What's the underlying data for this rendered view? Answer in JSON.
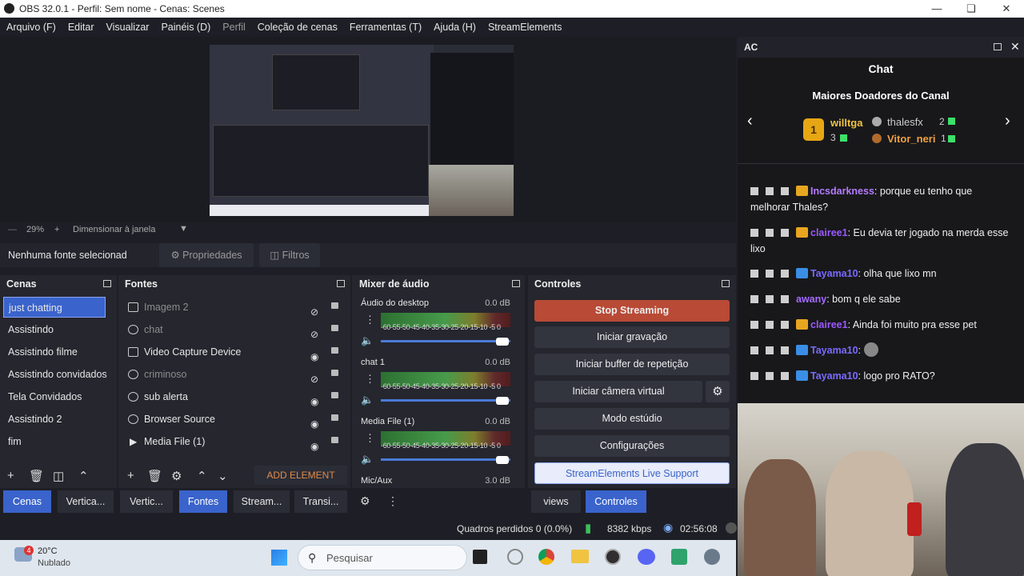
{
  "window": {
    "title": "OBS 32.0.1 - Perfil: Sem nome - Cenas: Scenes"
  },
  "menu": [
    "Arquivo (F)",
    "Editar",
    "Visualizar",
    "Painéis (D)",
    "Perfil",
    "Coleção de cenas",
    "Ferramentas (T)",
    "Ajuda (H)",
    "StreamElements"
  ],
  "preview": {
    "zoom": "29%",
    "zoom_plus": "+",
    "fit_label": "Dimensionar à janela"
  },
  "source_toolbar": {
    "status": "Nenhuma fonte selecionad",
    "properties": "Propriedades",
    "filters": "Filtros"
  },
  "scenes": {
    "header": "Cenas",
    "items": [
      "just chatting",
      "Assistindo",
      "Assistindo filme",
      "Assistindo convidados",
      "Tela Convidados",
      "Assistindo 2",
      "fim"
    ],
    "selected_index": 0
  },
  "sources": {
    "header": "Fontes",
    "items": [
      {
        "label": "Imagem 2",
        "visible": false
      },
      {
        "label": "chat",
        "visible": false
      },
      {
        "label": "Video Capture Device",
        "visible": true
      },
      {
        "label": "criminoso",
        "visible": false
      },
      {
        "label": "sub alerta",
        "visible": true
      },
      {
        "label": "Browser Source",
        "visible": true
      },
      {
        "label": "Media File (1)",
        "visible": true
      }
    ],
    "add_element": "ADD ELEMENT"
  },
  "mixer": {
    "header": "Mixer de áudio",
    "scale": "-60-55-50-45-40-35-30-25-20-15-10 -5  0",
    "channels": [
      {
        "name": "Áudio do desktop",
        "db": "0.0 dB"
      },
      {
        "name": "chat 1",
        "db": "0.0 dB"
      },
      {
        "name": "Media File (1)",
        "db": "0.0 dB"
      },
      {
        "name": "Mic/Aux",
        "db": "3.0 dB"
      }
    ]
  },
  "controls": {
    "header": "Controles",
    "stop_streaming": "Stop Streaming",
    "start_recording": "Iniciar gravação",
    "replay_buffer": "Iniciar buffer de repetição",
    "virtual_camera": "Iniciar câmera virtual",
    "studio_mode": "Modo estúdio",
    "settings": "Configurações",
    "se_support": "StreamElements Live Support"
  },
  "bottom_tabs": {
    "left": [
      "Cenas",
      "Vertica...",
      "Vertic...",
      "Fontes",
      "Stream...",
      "Transi..."
    ],
    "right": [
      "views",
      "Controles"
    ]
  },
  "status": {
    "dropped_frames": "Quadros perdidos 0 (0.0%)",
    "bitrate": "8382 kbps",
    "time": "02:56:08"
  },
  "chat_dock": {
    "dock_title": "AC",
    "title": "Chat",
    "leaderboard_title": "Maiores Doadores do Canal",
    "top1": {
      "rank": "1",
      "name": "willtga",
      "count": "3"
    },
    "top2": {
      "name": "thalesfx",
      "count": "2"
    },
    "top3": {
      "name": "Vitor_neri",
      "count": "1"
    },
    "messages": [
      {
        "user": "Incsdarkness",
        "text": "porque eu tenho que melhorar Thales?",
        "color": "#b57bff"
      },
      {
        "user": "clairee1",
        "text": "Eu devia ter jogado na merda esse lixo",
        "color": "#9b59ff"
      },
      {
        "user": "Tayama10",
        "text": "olha que lixo mn",
        "color": "#7a6bff"
      },
      {
        "user": "awany",
        "text": "bom q ele sabe",
        "color": "#a56bff"
      },
      {
        "user": "clairee1",
        "text": "Ainda foi muito pra esse pet",
        "color": "#9b59ff"
      },
      {
        "user": "Tayama10",
        "text": "",
        "color": "#7a6bff"
      },
      {
        "user": "Tayama10",
        "text": "logo pro RATO?",
        "color": "#7a6bff"
      }
    ]
  },
  "taskbar": {
    "weather_temp": "20°C",
    "weather_desc": "Nublado",
    "weather_badge": "4",
    "search_placeholder": "Pesquisar"
  }
}
